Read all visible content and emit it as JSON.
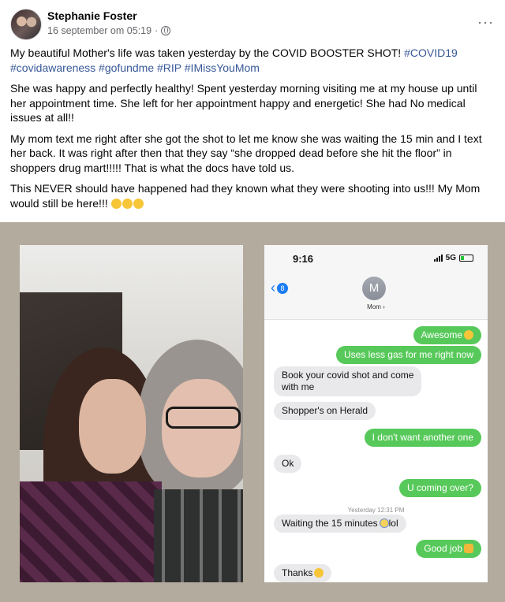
{
  "post": {
    "author": "Stephanie Foster",
    "timestamp": "16 september om 05:19",
    "separator": "·",
    "more": "···",
    "paragraphs": {
      "p1_text": "My beautiful Mother's life was taken yesterday by the COVID BOOSTER SHOT! ",
      "p1_tags": "#COVID19 #covidawareness #gofundme #RIP #IMissYouMom",
      "p2": "She was happy and perfectly healthy! Spent yesterday morning visiting me at my house up until her appointment time. She left for her appointment happy and energetic! She had No medical issues at all!!",
      "p3": "My mom text me right after she got the shot to let me know she was waiting the 15 min and I text her back. It was right after then that they say “she dropped dead before she hit the floor” in shoppers drug mart!!!!! That is what the docs have told us.",
      "p4": "This NEVER should have happened had they known what they were shooting into us!!! My Mom would still be here!!! "
    }
  },
  "phone": {
    "time": "9:16",
    "network": "5G",
    "back_count": "8",
    "contact_initial": "M",
    "contact_name": "Mom ›",
    "messages": [
      {
        "dir": "sent",
        "text": "Awesome"
      },
      {
        "dir": "sent",
        "text": "Uses less gas for me right now"
      },
      {
        "dir": "recv",
        "text": "Book your covid shot and come\nwith me"
      },
      {
        "dir": "recv",
        "text": "Shopper's on Herald"
      },
      {
        "dir": "sent",
        "text": "I don't want another one"
      },
      {
        "dir": "recv",
        "text": "Ok"
      },
      {
        "dir": "sent",
        "text": "U coming over?"
      },
      {
        "dir": "recv",
        "text": "Waiting the 15 minutes"
      },
      {
        "dir": "recv",
        "text": "lol"
      },
      {
        "dir": "sent",
        "text": "Good job"
      },
      {
        "dir": "recv",
        "text": "Thanks"
      }
    ],
    "timestamp": "Yesterday 12:31 PM"
  },
  "colors": {
    "hashtag": "#385898",
    "sent_bubble": "#57c95a",
    "recv_bubble": "#e9e9eb",
    "ios_blue": "#1a7cf5",
    "image_bg": "#b3ab9d"
  },
  "icons": [
    "globe-icon",
    "more-options-icon",
    "back-chevron-icon",
    "signal-icon",
    "battery-icon",
    "crying-emoji-icon",
    "grin-emoji-icon",
    "scream-emoji-icon",
    "clap-emoji-icon",
    "smile-emoji-icon"
  ]
}
